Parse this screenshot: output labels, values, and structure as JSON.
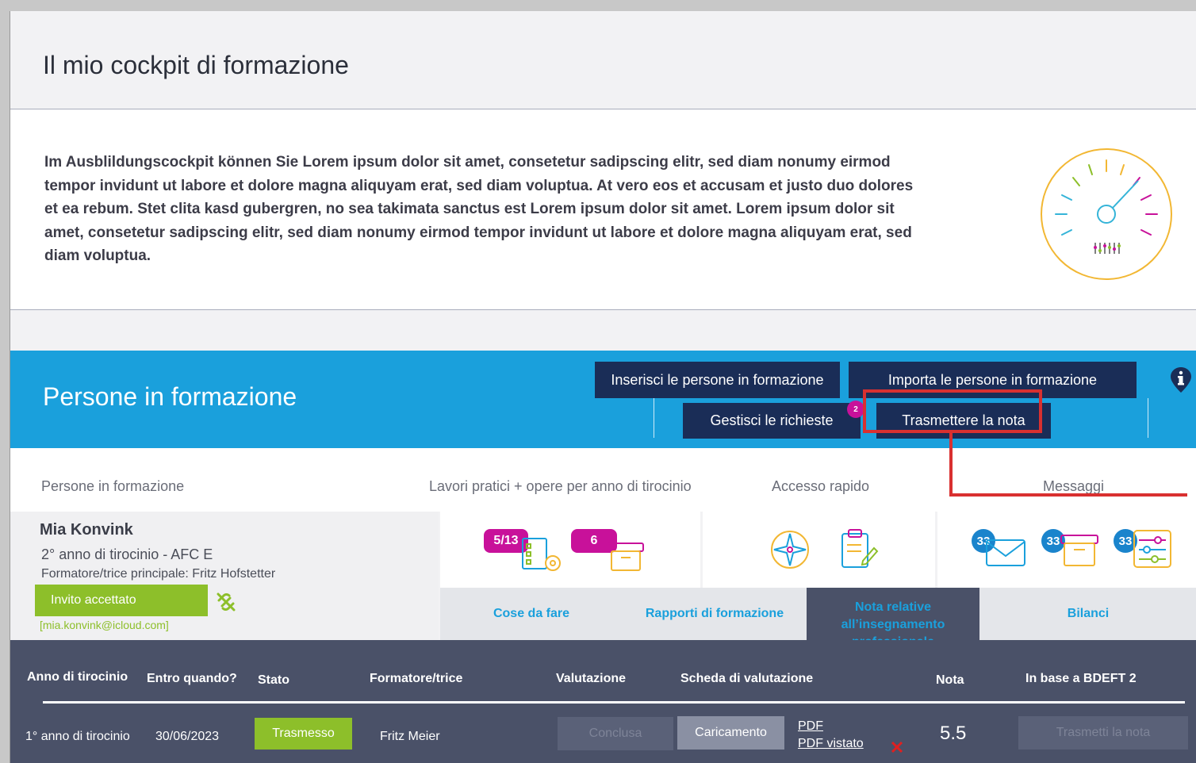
{
  "header": {
    "title": "Il mio cockpit di formazione"
  },
  "intro": {
    "text": "Im Ausblildungscockpit können Sie Lorem ipsum dolor sit amet, consetetur sadipscing elitr, sed diam nonumy eirmod tempor invidunt ut labore et dolore magna aliquyam erat, sed diam voluptua. At vero eos et accusam et justo duo dolores et ea rebum. Stet clita kasd gubergren, no sea takimata sanctus est Lorem ipsum dolor sit amet. Lorem ipsum dolor sit amet, consetetur sadipscing elitr, sed diam nonumy eirmod tempor invidunt ut labore et dolore magna aliquyam erat, sed diam voluptua.",
    "icon": "speedometer-icon"
  },
  "banner": {
    "title": "Persone in formazione",
    "buttons": {
      "add": "Inserisci le persone in formazione",
      "import": "Importa le persone in formazione",
      "requests": "Gestisci le richieste",
      "requests_badge": "2",
      "transmit": "Trasmettere la nota"
    },
    "colors": {
      "banner": "#1aa0dc",
      "button": "#1a2d57",
      "highlight": "#d93030"
    }
  },
  "columns": {
    "learners": "Persone in formazione",
    "works": "Lavori pratici + opere per anno di tirocinio",
    "quick": "Accesso rapido",
    "messages": "Messaggi"
  },
  "learner": {
    "name": "Mia Konvink",
    "year": "2° anno di tirocinio - AFC E",
    "trainer": "Formatore/trice principale: Fritz Hofstetter",
    "status": "Invito accettato",
    "email": "[mia.konvink@icloud.com]"
  },
  "works": {
    "count1": "5/13",
    "count2": "6"
  },
  "messages": {
    "count1": "33",
    "count2": "33",
    "count3": "33"
  },
  "tabs": {
    "todo": "Cose da fare",
    "reports": "Rapporti di formazione",
    "grades": "Nota relative all’insegnamento professionale",
    "balances": "Bilanci"
  },
  "table": {
    "headers": {
      "year": "Anno di tirocinio",
      "due": "Entro quando?",
      "status": "Stato",
      "trainer": "Formatore/trice",
      "evaluation": "Valutazione",
      "sheet": "Scheda di valutazione",
      "grade": "Nota",
      "bdeft": "In base a BDEFT 2"
    },
    "row": {
      "year": "1° anno di tirocinio",
      "due": "30/06/2023",
      "status": "Trasmesso",
      "trainer": "Fritz Meier",
      "evaluation": "Conclusa",
      "upload": "Caricamento",
      "pdf": "PDF",
      "pdf_signed": "PDF vistato",
      "grade": "5.5",
      "transmit": "Trasmetti la nota"
    }
  }
}
